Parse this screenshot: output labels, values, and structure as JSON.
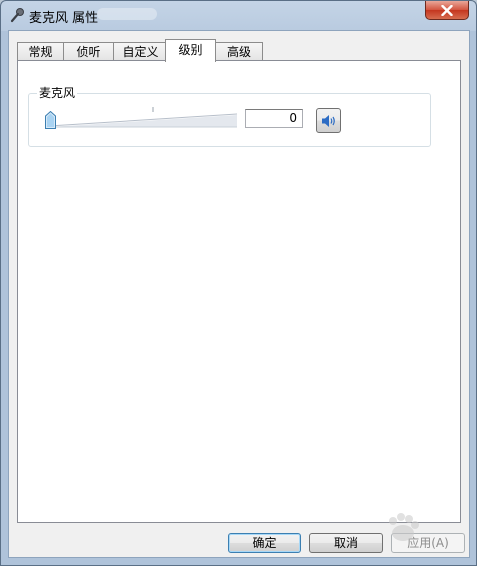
{
  "window": {
    "title": "麦克风 属性"
  },
  "tabs": [
    {
      "label": "常规"
    },
    {
      "label": "侦听"
    },
    {
      "label": "自定义"
    },
    {
      "label": "级别"
    },
    {
      "label": "高级"
    }
  ],
  "active_tab": "级别",
  "levels": {
    "group_label": "麦克风",
    "volume_value": "0",
    "volume_level_percent": 0,
    "mute_icon": "speaker-icon"
  },
  "buttons": {
    "ok": "确定",
    "cancel": "取消",
    "apply": "应用(A)"
  },
  "colors": {
    "titlebar": "#b9cbe0",
    "close_button": "#c4361f",
    "panel_bg": "#ffffff",
    "dialog_bg": "#f0f0f0",
    "default_button_border": "#3c7fb1",
    "speaker_icon": "#2c6cc4"
  }
}
